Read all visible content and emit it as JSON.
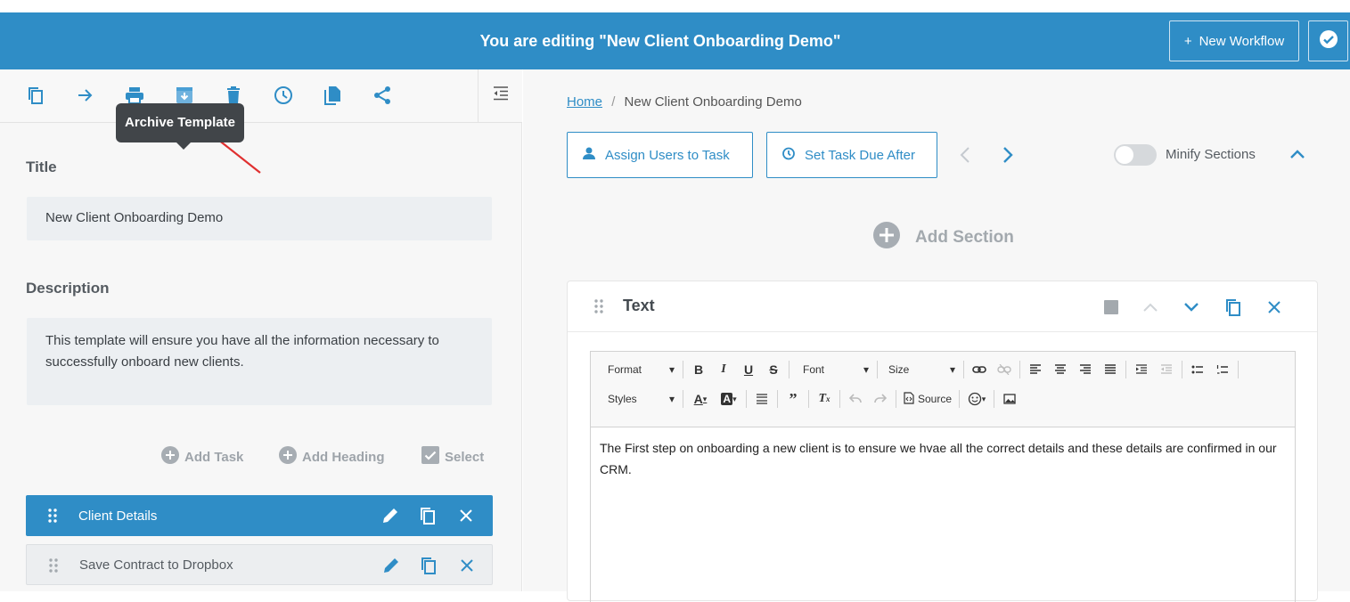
{
  "header": {
    "title": "You are editing \"New Client Onboarding Demo\"",
    "new_workflow_label": "New Workflow",
    "new_workflow_plus": "+",
    "accent": "#2f8dc6"
  },
  "left_toolbar": {
    "tooltip": "Archive Template",
    "icons": [
      "copy-icon",
      "arrow-right-icon",
      "print-icon",
      "archive-icon",
      "trash-icon",
      "clock-icon",
      "file-copy-icon",
      "share-icon",
      "outdent-icon"
    ]
  },
  "template": {
    "title_label": "Title",
    "title_value": "New Client Onboarding Demo",
    "description_label": "Description",
    "description_value": "This template will ensure you have all the information necessary to successfully onboard new clients."
  },
  "task_actions": {
    "add_task": "Add Task",
    "add_heading": "Add Heading",
    "select": "Select"
  },
  "tasks": [
    {
      "label": "Client Details",
      "active": true
    },
    {
      "label": "Save Contract to Dropbox",
      "active": false
    }
  ],
  "breadcrumb": {
    "home": "Home",
    "separator": "/",
    "current": "New Client Onboarding Demo"
  },
  "task_toolbar": {
    "assign_users": "Assign Users to Task",
    "set_due": "Set Task Due After",
    "minify_sections": "Minify Sections",
    "minify_enabled": false
  },
  "add_section": "Add Section",
  "section": {
    "title": "Text",
    "editor": {
      "format": "Format",
      "font": "Font",
      "size": "Size",
      "styles": "Styles",
      "source": "Source",
      "content": "The First step on onboarding a new client is to ensure we hvae all the correct details and these details are confirmed in our CRM."
    }
  }
}
